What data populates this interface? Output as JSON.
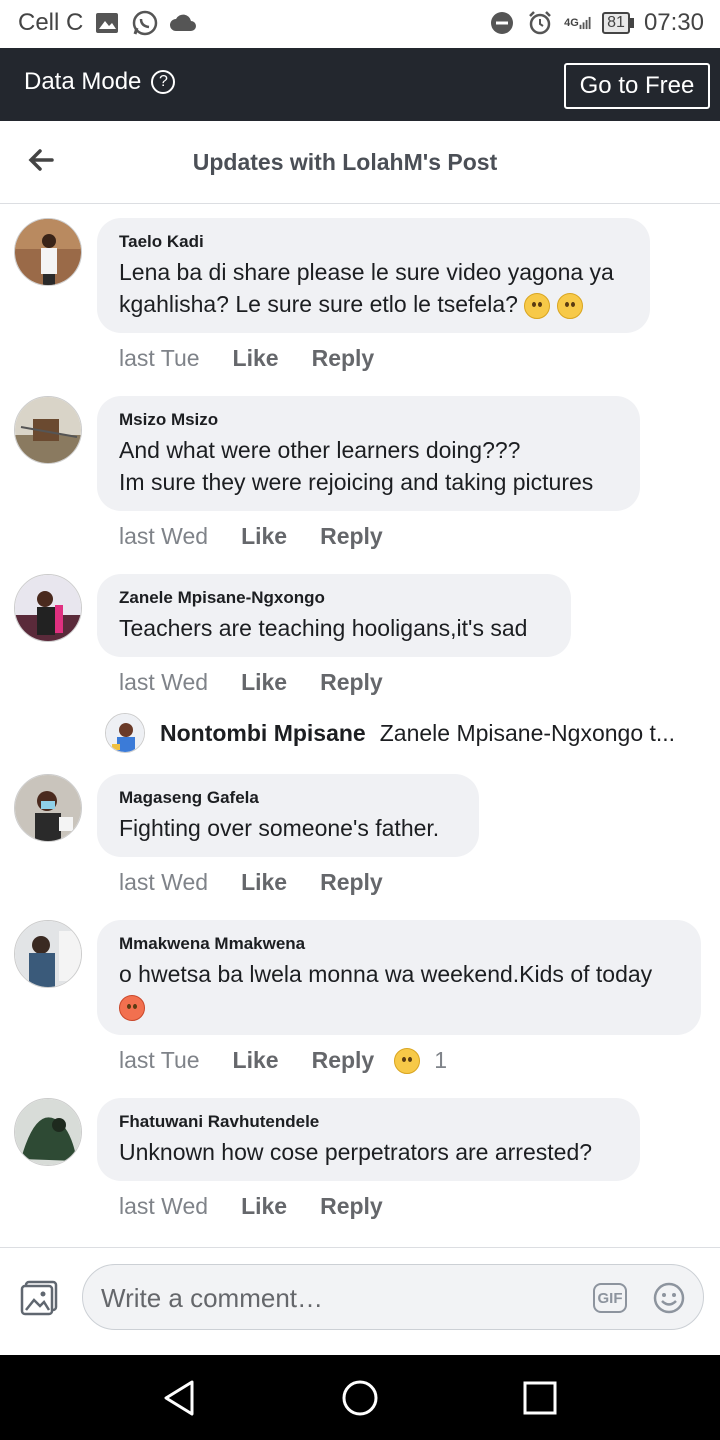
{
  "status": {
    "carrier": "Cell C",
    "network": "4G",
    "battery": "81",
    "time": "07:30"
  },
  "data_mode": {
    "label": "Data Mode",
    "help_glyph": "?",
    "go_free_label": "Go to Free"
  },
  "header": {
    "title": "Updates with LolahM's Post"
  },
  "comments": [
    {
      "name": "Taelo Kadi",
      "lines": [
        "Lena ba di share please le sure video yagona ya",
        "kgahlisha? Le sure sure etlo le tsefela?"
      ],
      "time": "last Tue",
      "like": "Like",
      "reply": "Reply"
    },
    {
      "name": "Msizo Msizo",
      "lines": [
        "And what were other learners doing???",
        "Im sure they were rejoicing and taking pictures"
      ],
      "time": "last Wed",
      "like": "Like",
      "reply": "Reply"
    },
    {
      "name": "Zanele Mpisane-Ngxongo",
      "lines": [
        "Teachers are teaching hooligans,it's sad"
      ],
      "time": "last Wed",
      "like": "Like",
      "reply": "Reply"
    },
    {
      "name": "Magaseng Gafela",
      "lines": [
        "Fighting over someone's father."
      ],
      "time": "last Wed",
      "like": "Like",
      "reply": "Reply"
    },
    {
      "name": "Mmakwena Mmakwena",
      "lines": [
        "o hwetsa ba lwela monna wa weekend.Kids of today"
      ],
      "time": "last Tue",
      "like": "Like",
      "reply": "Reply",
      "reaction_count": "1"
    },
    {
      "name": "Fhatuwani Ravhutendele",
      "lines": [
        "Unknown how cose perpetrators are arrested?"
      ],
      "time": "last Wed",
      "like": "Like",
      "reply": "Reply"
    }
  ],
  "reply_preview": {
    "name": "Nontombi Mpisane",
    "text": "Zanele Mpisane-Ngxongo t..."
  },
  "composer": {
    "placeholder": "Write a comment…",
    "gif_label": "GIF"
  },
  "colors": {
    "databar": "#23272e",
    "bubble": "#f0f1f4",
    "navbar": "#000000"
  }
}
